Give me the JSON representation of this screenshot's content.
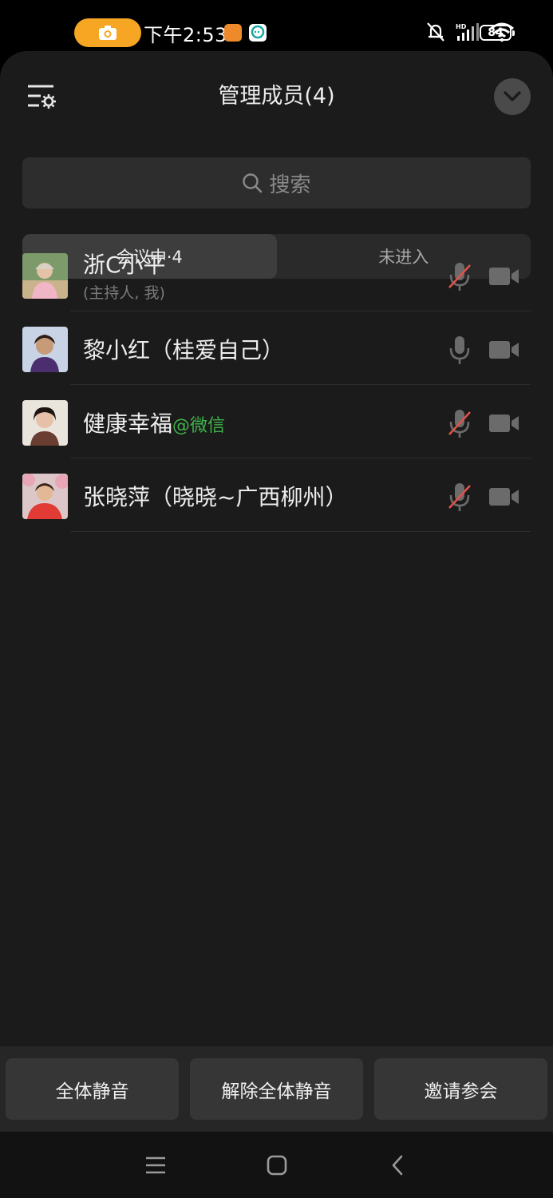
{
  "status_bar": {
    "time": "下午2:53",
    "battery": "84",
    "icons": [
      "camera-record-icon",
      "app-orange-icon",
      "app-chat-icon",
      "mute-bell-icon",
      "hd-signal-icon",
      "wifi-icon",
      "battery-icon"
    ]
  },
  "header": {
    "title": "管理成员(4)",
    "settings_icon": "list-settings-icon",
    "collapse_icon": "chevron-down-icon"
  },
  "search": {
    "placeholder": "搜索",
    "icon": "search-icon"
  },
  "tabs": [
    {
      "label": "会议中·4",
      "active": true
    },
    {
      "label": "未进入",
      "active": false
    }
  ],
  "members": [
    {
      "name": "浙C小平",
      "sub": "(主持人, 我)",
      "tag": "",
      "mic": "muted",
      "camera": "off",
      "avatar_color": "#6b8a5c"
    },
    {
      "name": "黎小红（桂爱自己）",
      "sub": "",
      "tag": "",
      "mic": "on",
      "camera": "off",
      "avatar_color": "#4a3c6e"
    },
    {
      "name": "健康幸福",
      "sub": "",
      "tag": "@微信",
      "mic": "muted",
      "camera": "off",
      "avatar_color": "#c9b9a8"
    },
    {
      "name": "张晓萍（晓晓~广西柳州）",
      "sub": "",
      "tag": "",
      "mic": "muted",
      "camera": "off",
      "avatar_color": "#c84a3c"
    }
  ],
  "footer": {
    "mute_all": "全体静音",
    "unmute_all": "解除全体静音",
    "invite": "邀请参会"
  },
  "navbar": {
    "icons": [
      "menu-icon",
      "home-icon",
      "back-icon"
    ]
  },
  "colors": {
    "accent_orange": "#f6a623",
    "wechat_green": "#3fb24a",
    "muted_red": "#e0524a",
    "panel_bg": "#1b1b1b"
  }
}
